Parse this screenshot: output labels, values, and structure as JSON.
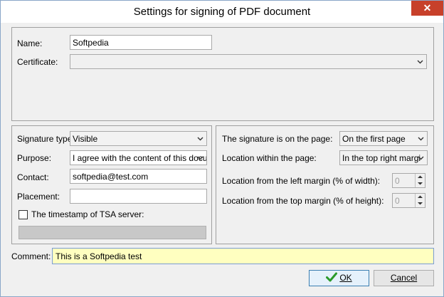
{
  "window": {
    "title": "Settings for signing of PDF document",
    "close_glyph": "✕"
  },
  "top_panel": {
    "name_label": "Name:",
    "name_value": "Softpedia",
    "certificate_label": "Certificate:",
    "certificate_value": ""
  },
  "left_panel": {
    "signature_type_label": "Signature type:",
    "signature_type_value": "Visible",
    "purpose_label": "Purpose:",
    "purpose_value": "I agree with the content of this docu",
    "contact_label": "Contact:",
    "contact_value": "softpedia@test.com",
    "placement_label": "Placement:",
    "placement_value": "",
    "tsa_label": "The timestamp of TSA server:",
    "tsa_checked": false
  },
  "right_panel": {
    "page_label": "The signature is on the page:",
    "page_value": "On the first page",
    "location_label": "Location within the page:",
    "location_value": "In the top right margi",
    "left_margin_label": "Location from the left margin (% of width):",
    "left_margin_value": "0",
    "top_margin_label": "Location from the top margin (% of height):",
    "top_margin_value": "0"
  },
  "comment": {
    "label": "Comment:",
    "value": "This is a Softpedia test"
  },
  "buttons": {
    "ok_label": "OK",
    "cancel_label": "Cancel"
  },
  "colors": {
    "close_button": "#c7402a",
    "comment_background": "#ffffc0",
    "ok_check": "#2a9a2a"
  }
}
